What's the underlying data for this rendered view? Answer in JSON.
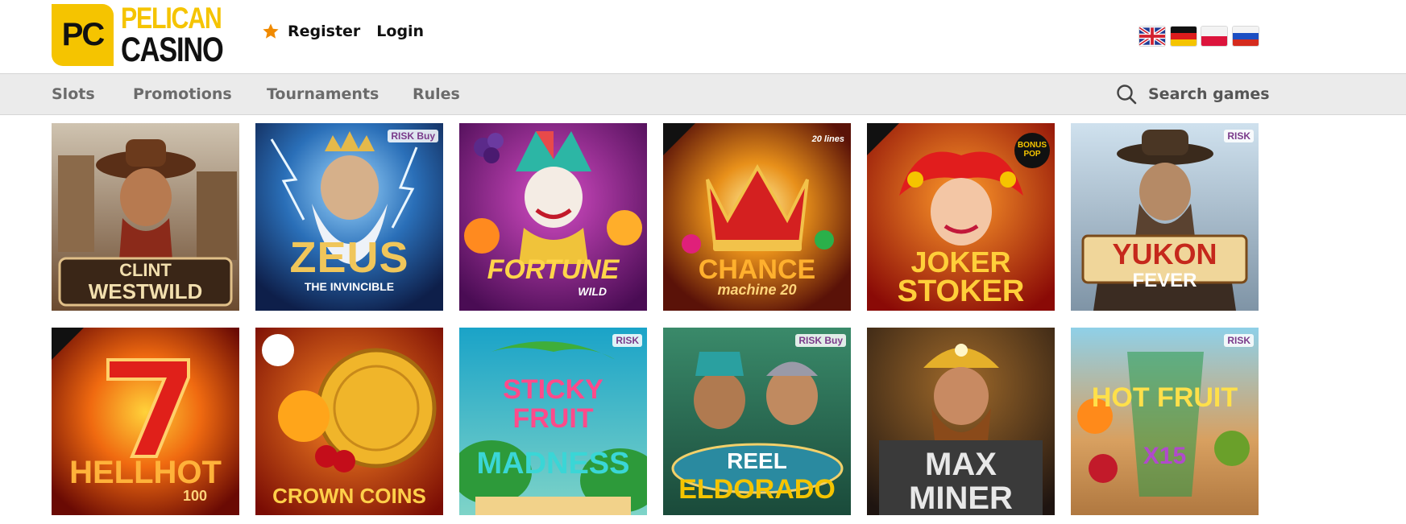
{
  "brand": {
    "logo_mark": "PC",
    "logo_word1": "PELICAN",
    "logo_word2": "CASINO",
    "accent": "#f5c400"
  },
  "auth": {
    "register_label": "Register",
    "login_label": "Login",
    "star_color": "#f08a00"
  },
  "languages": [
    {
      "code": "en",
      "icon": "uk-flag-icon"
    },
    {
      "code": "de",
      "icon": "germany-flag-icon"
    },
    {
      "code": "pl",
      "icon": "poland-flag-icon"
    },
    {
      "code": "ru",
      "icon": "russia-flag-icon"
    }
  ],
  "nav": {
    "items": [
      {
        "label": "Slots"
      },
      {
        "label": "Promotions"
      },
      {
        "label": "Tournaments"
      },
      {
        "label": "Rules"
      }
    ],
    "search_placeholder": "Search games"
  },
  "games": [
    {
      "line1": "CLINT",
      "line2": "WESTWILD",
      "badge": ""
    },
    {
      "line1": "ZEUS",
      "line2": "THE INVINCIBLE",
      "badge": "RISK Buy"
    },
    {
      "line1": "FORTUNE",
      "line2": "WILD",
      "badge": ""
    },
    {
      "line1": "CHANCE",
      "line2": "machine 20",
      "badge": "20 lines"
    },
    {
      "line1": "JOKER",
      "line2": "STOKER",
      "badge": "BONUS POP"
    },
    {
      "line1": "YUKON",
      "line2": "FEVER",
      "badge": "RISK"
    },
    {
      "line1": "HELLHOT",
      "line2": "100",
      "badge": ""
    },
    {
      "line1": "CROWN",
      "line2": "COINS",
      "badge": ""
    },
    {
      "line1": "STICKY FRUIT",
      "line2": "MADNESS",
      "badge": "RISK"
    },
    {
      "line1": "REEL",
      "line2": "ELDORADO",
      "badge": "RISK Buy"
    },
    {
      "line1": "MAX",
      "line2": "MINER",
      "badge": ""
    },
    {
      "line1": "HOT FRUIT",
      "line2": "X15",
      "badge": "RISK"
    }
  ]
}
